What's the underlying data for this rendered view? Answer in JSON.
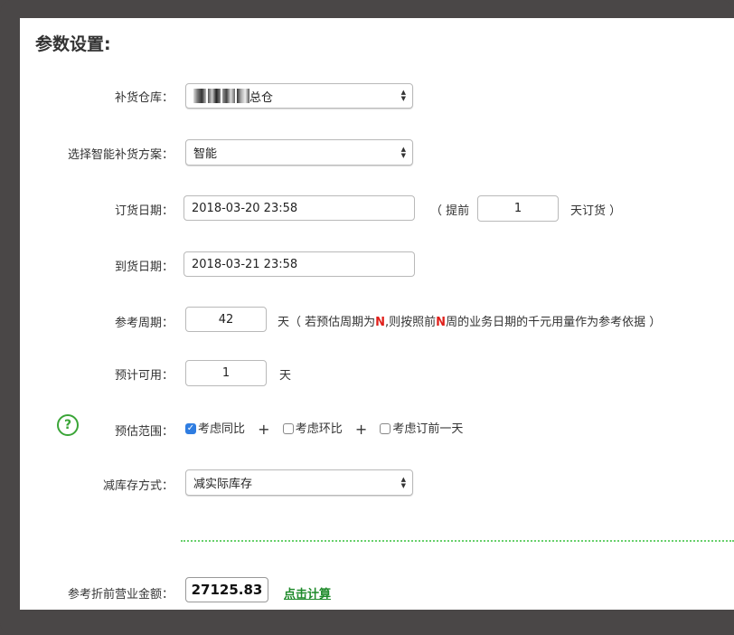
{
  "title": "参数设置:",
  "warehouse": {
    "label": "补货仓库：",
    "value": "总仓"
  },
  "plan": {
    "label": "选择智能补货方案：",
    "value": "智能"
  },
  "order_date": {
    "label": "订货日期：",
    "value": "2018-03-20 23:58",
    "ahead_prefix": "（ 提前",
    "ahead_value": "1",
    "ahead_suffix": "天订货 ）"
  },
  "arrival_date": {
    "label": "到货日期：",
    "value": "2018-03-21 23:58"
  },
  "ref_period": {
    "label": "参考周期：",
    "value": "42",
    "note_a": "天（ 若预估周期为",
    "note_n1": "N",
    "note_b": ",则按照前",
    "note_n2": "N",
    "note_c": "周的业务日期的千元用量作为参考依据 ）"
  },
  "expected": {
    "label": "预计可用：",
    "value": "1",
    "unit": "天"
  },
  "estimate_range": {
    "label": "预估范围：",
    "options": [
      {
        "label": "考虑同比",
        "checked": true
      },
      {
        "label": "考虑环比",
        "checked": false
      },
      {
        "label": "考虑订前一天",
        "checked": false
      }
    ],
    "plus": "+"
  },
  "stock_method": {
    "label": "减库存方式：",
    "value": "减实际库存"
  },
  "ref_amount": {
    "label": "参考折前营业金额：",
    "value": "27125.83",
    "action": "点击计算"
  },
  "colors": {
    "accent_green": "#3aa537",
    "check_blue": "#2f7de1",
    "highlight_red": "#e0201b"
  }
}
